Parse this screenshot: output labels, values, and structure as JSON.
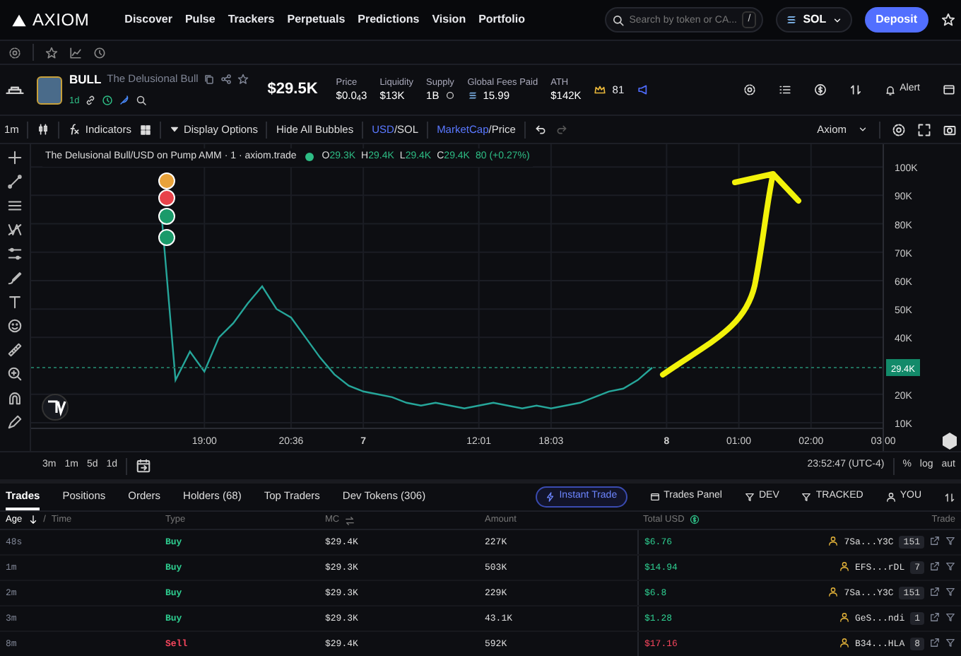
{
  "nav": {
    "logo": "AXIOM",
    "links": [
      "Discover",
      "Pulse",
      "Trackers",
      "Perpetuals",
      "Predictions",
      "Vision",
      "Portfolio"
    ],
    "search": {
      "placeholder": "Search by token or CA...",
      "shortcut": "/"
    },
    "chain": "SOL",
    "deposit": "Deposit"
  },
  "token": {
    "symbol": "BULL",
    "name": "The Delusional Bull",
    "age": "1d",
    "market_cap": "$29.5K",
    "stats": [
      {
        "kind": "plain",
        "label": "Price",
        "value": "$0.0$_{4}$3"
      },
      {
        "kind": "plain",
        "label": "Liquidity",
        "value": "$13K"
      },
      {
        "kind": "supply",
        "label": "Supply",
        "value": "1B"
      },
      {
        "kind": "fees",
        "label": "Global Fees Paid",
        "value": "15.99"
      },
      {
        "kind": "plain",
        "label": "ATH",
        "value": "$142K"
      }
    ],
    "badge": "81",
    "alert": "Alert"
  },
  "chart_toolbar": {
    "interval": "1m",
    "indicators": "Indicators",
    "display_options": "Display Options",
    "bubbles": "Hide All Bubbles",
    "currency": {
      "separator": "/",
      "options": [
        {
          "label": "USD",
          "selected": true
        },
        {
          "label": "SOL",
          "selected": false
        }
      ]
    },
    "metric": {
      "separator": "/",
      "options": [
        {
          "label": "MarketCap",
          "selected": true
        },
        {
          "label": "Price",
          "selected": false
        }
      ]
    },
    "theme": "Axiom"
  },
  "legend": {
    "title": "The Delusional Bull/USD on Pump AMM · 1 · axiom.trade",
    "ohlc": [
      {
        "label": "O",
        "value": "29.3K"
      },
      {
        "label": "H",
        "value": "29.4K"
      },
      {
        "label": "L",
        "value": "29.4K"
      },
      {
        "label": "C",
        "value": "29.4K"
      }
    ],
    "change": "80 (+0.27%)"
  },
  "chart": {
    "last_price": "29.4K",
    "chart_data": {
      "type": "line",
      "categories": [
        null,
        null,
        null,
        "19:00",
        null,
        null,
        null,
        null,
        null,
        "20:36",
        null,
        null,
        null,
        null,
        "7",
        null,
        null,
        null,
        null,
        null,
        null,
        null,
        "12:01",
        null,
        null,
        null,
        null,
        "18:03",
        null,
        null,
        null,
        null,
        null,
        null,
        null,
        "8",
        null,
        null,
        null,
        null,
        "01:00",
        null,
        null,
        null,
        null,
        "02:00",
        null,
        null,
        null,
        null,
        "03:00"
      ],
      "values": [
        85000,
        25000,
        35000,
        28000,
        40000,
        45000,
        52000,
        58000,
        50000,
        47000,
        40000,
        33000,
        27000,
        23000,
        21000,
        20000,
        19000,
        17000,
        16000,
        17000,
        16000,
        15000,
        16000,
        17000,
        16000,
        15000,
        16000,
        15000,
        16000,
        17000,
        19000,
        21000,
        22000,
        25000,
        29400,
        null,
        null,
        null,
        null,
        null,
        null,
        null,
        null,
        null,
        null,
        null,
        null,
        null,
        null,
        null,
        null
      ],
      "ylim": [
        8000,
        108000
      ],
      "grid": true,
      "yticks": [
        {
          "value": 100000,
          "label": "100K"
        },
        {
          "value": 90000,
          "label": "90K"
        },
        {
          "value": 80000,
          "label": "80K"
        },
        {
          "value": 70000,
          "label": "70K"
        },
        {
          "value": 60000,
          "label": "60K"
        },
        {
          "value": 50000,
          "label": "50K"
        },
        {
          "value": 40000,
          "label": "40K"
        },
        {
          "value": 20000,
          "label": "20K"
        },
        {
          "value": 10000,
          "label": "10K"
        }
      ]
    }
  },
  "chart_footer": {
    "timeframes": [
      "3m",
      "1m",
      "5d",
      "1d"
    ],
    "clock": "23:52:47 (UTC-4)",
    "scale_options": [
      "%",
      "log",
      "aut"
    ]
  },
  "tabs": [
    {
      "label": "Trades",
      "selected": true
    },
    {
      "label": "Positions",
      "selected": false
    },
    {
      "label": "Orders",
      "selected": false
    },
    {
      "label": "Holders (68)",
      "selected": false
    },
    {
      "label": "Top Traders",
      "selected": false
    },
    {
      "label": "Dev Tokens (306)",
      "selected": false
    }
  ],
  "trade_controls": [
    {
      "kind": "instant",
      "label": "Instant Trade"
    },
    {
      "kind": "panel",
      "label": "Trades Panel"
    },
    {
      "kind": "filter",
      "label": "DEV"
    },
    {
      "kind": "filter",
      "label": "TRACKED"
    },
    {
      "kind": "user",
      "label": "YOU"
    }
  ],
  "table": {
    "columns": [
      "Age",
      "Time",
      "Type",
      "MC",
      "Amount",
      "Total USD",
      "Trade"
    ],
    "header_separator": "/",
    "rows": [
      {
        "age": "48s",
        "kind": "buy",
        "type": "Buy",
        "mc": "$29.4K",
        "amount": "227K",
        "total": "$6.76",
        "trader": "7Sa...Y3C",
        "count": "151"
      },
      {
        "age": "1m",
        "kind": "buy",
        "type": "Buy",
        "mc": "$29.3K",
        "amount": "503K",
        "total": "$14.94",
        "trader": "EFS...rDL",
        "count": "7"
      },
      {
        "age": "2m",
        "kind": "buy",
        "type": "Buy",
        "mc": "$29.3K",
        "amount": "229K",
        "total": "$6.8",
        "trader": "7Sa...Y3C",
        "count": "151"
      },
      {
        "age": "3m",
        "kind": "buy",
        "type": "Buy",
        "mc": "$29.3K",
        "amount": "43.1K",
        "total": "$1.28",
        "trader": "GeS...ndi",
        "count": "1"
      },
      {
        "age": "8m",
        "kind": "sell",
        "type": "Sell",
        "mc": "$29.4K",
        "amount": "592K",
        "total": "$17.16",
        "trader": "B34...HLA",
        "count": "8"
      }
    ]
  }
}
